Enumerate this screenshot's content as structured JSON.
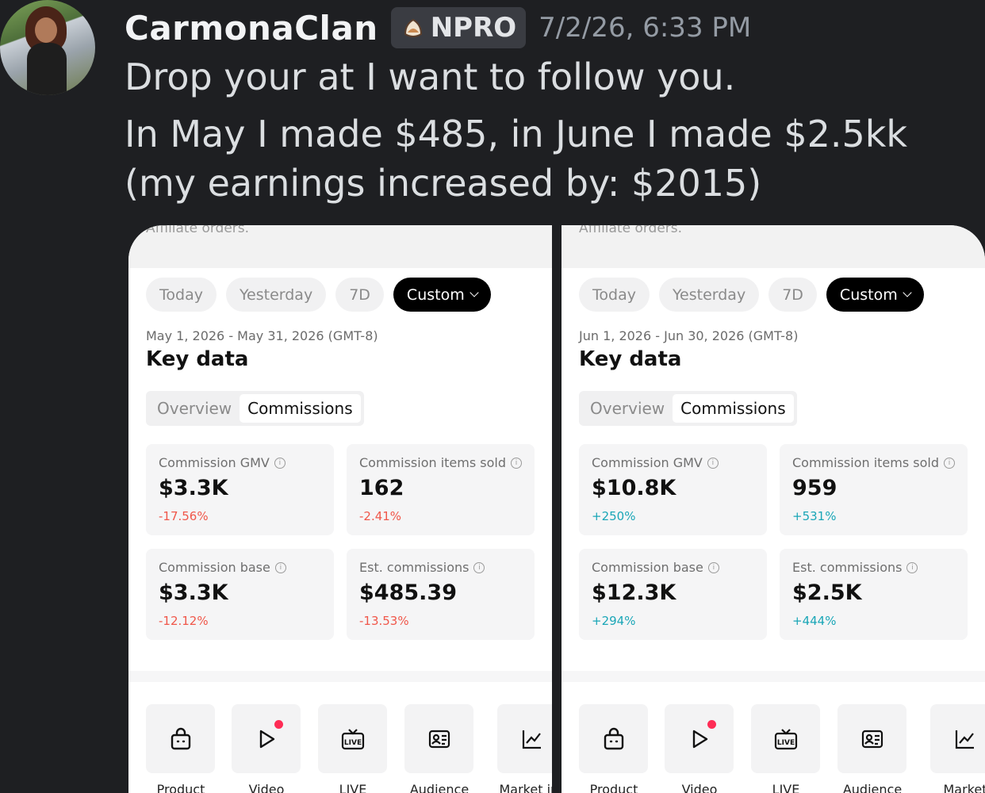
{
  "message": {
    "username": "CarmonaClan",
    "tag": "NPRO",
    "tag_icon": "pouch-icon",
    "timestamp": "7/2/26, 6:33 PM",
    "line1": "Drop your at I want to follow you.",
    "line2": "In May I made $485, in June I made $2.5kk (my earnings increased by: $2015)"
  },
  "screenshots": [
    {
      "top_text": "Affiliate orders.",
      "chips": [
        "Today",
        "Yesterday",
        "7D",
        "Custom"
      ],
      "date_range": "May 1, 2026 - May 31, 2026 (GMT-8)",
      "section_title": "Key data",
      "tabs": [
        "Overview",
        "Commissions"
      ],
      "metrics": [
        {
          "label": "Commission GMV",
          "value": "$3.3K",
          "change": "-17.56%"
        },
        {
          "label": "Commission items sold",
          "value": "162",
          "change": "-2.41%"
        },
        {
          "label": "Commission base",
          "value": "$3.3K",
          "change": "-12.12%"
        },
        {
          "label": "Est. commissions",
          "value": "$485.39",
          "change": "-13.53%"
        }
      ],
      "tools": [
        "Product",
        "Video",
        "LIVE",
        "Audience",
        "Market ins"
      ]
    },
    {
      "top_text": "Affiliate orders.",
      "chips": [
        "Today",
        "Yesterday",
        "7D",
        "Custom"
      ],
      "date_range": "Jun 1, 2026 - Jun 30, 2026 (GMT-8)",
      "section_title": "Key data",
      "tabs": [
        "Overview",
        "Commissions"
      ],
      "metrics": [
        {
          "label": "Commission GMV",
          "value": "$10.8K",
          "change": "+250%"
        },
        {
          "label": "Commission items sold",
          "value": "959",
          "change": "+531%"
        },
        {
          "label": "Commission base",
          "value": "$12.3K",
          "change": "+294%"
        },
        {
          "label": "Est. commissions",
          "value": "$2.5K",
          "change": "+444%"
        }
      ],
      "tools": [
        "Product",
        "Video",
        "LIVE",
        "Audience",
        "Market"
      ]
    }
  ],
  "colors": {
    "negative": "#f0574a",
    "positive": "#1aa6b7",
    "background": "#1e1f22"
  }
}
